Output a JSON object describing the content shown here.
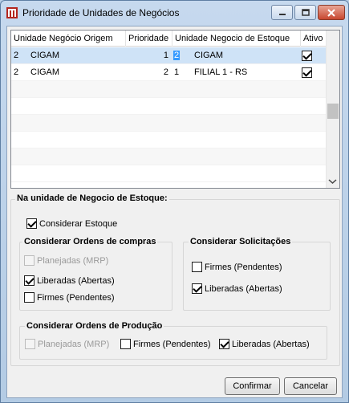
{
  "window": {
    "title": "Prioridade de Unidades de Negócios",
    "minimize_icon": "minimize-icon",
    "maximize_icon": "maximize-icon",
    "close_icon": "close-icon"
  },
  "grid": {
    "columns": [
      "Unidade Negócio Origem",
      "Prioridade",
      "Unidade Negocio de Estoque",
      "Ativo"
    ],
    "rows": [
      {
        "origem_codigo": "2",
        "origem_nome": "CIGAM",
        "prioridade": "1",
        "estoque_codigo": "2",
        "estoque_nome": "CIGAM",
        "ativo": true,
        "selected": true
      },
      {
        "origem_codigo": "2",
        "origem_nome": "CIGAM",
        "prioridade": "2",
        "estoque_codigo": "1",
        "estoque_nome": "FILIAL 1 - RS",
        "ativo": true,
        "selected": false
      }
    ]
  },
  "estoque_section": {
    "label": "Na unidade de Negocio de Estoque:",
    "considerar_estoque": {
      "label": "Considerar Estoque",
      "checked": true
    }
  },
  "ordens_compras": {
    "label": "Considerar Ordens de compras",
    "planejadas": {
      "label": "Planejadas (MRP)",
      "checked": false,
      "disabled": true
    },
    "liberadas": {
      "label": "Liberadas (Abertas)",
      "checked": true
    },
    "firmes": {
      "label": "Firmes (Pendentes)",
      "checked": false
    }
  },
  "solicitacoes": {
    "label": "Considerar Solicitações",
    "firmes": {
      "label": "Firmes (Pendentes)",
      "checked": false
    },
    "liberadas": {
      "label": "Liberadas (Abertas)",
      "checked": true
    }
  },
  "ordens_producao": {
    "label": "Considerar Ordens de Produção",
    "planejadas": {
      "label": "Planejadas (MRP)",
      "checked": false,
      "disabled": true
    },
    "firmes": {
      "label": "Firmes (Pendentes)",
      "checked": false
    },
    "liberadas": {
      "label": "Liberadas (Abertas)",
      "checked": true
    }
  },
  "buttons": {
    "confirmar": "Confirmar",
    "cancelar": "Cancelar"
  },
  "colors": {
    "selected_row": "#cfe3f7",
    "edit_highlight": "#3399ff",
    "close_button": "#c8472f"
  }
}
